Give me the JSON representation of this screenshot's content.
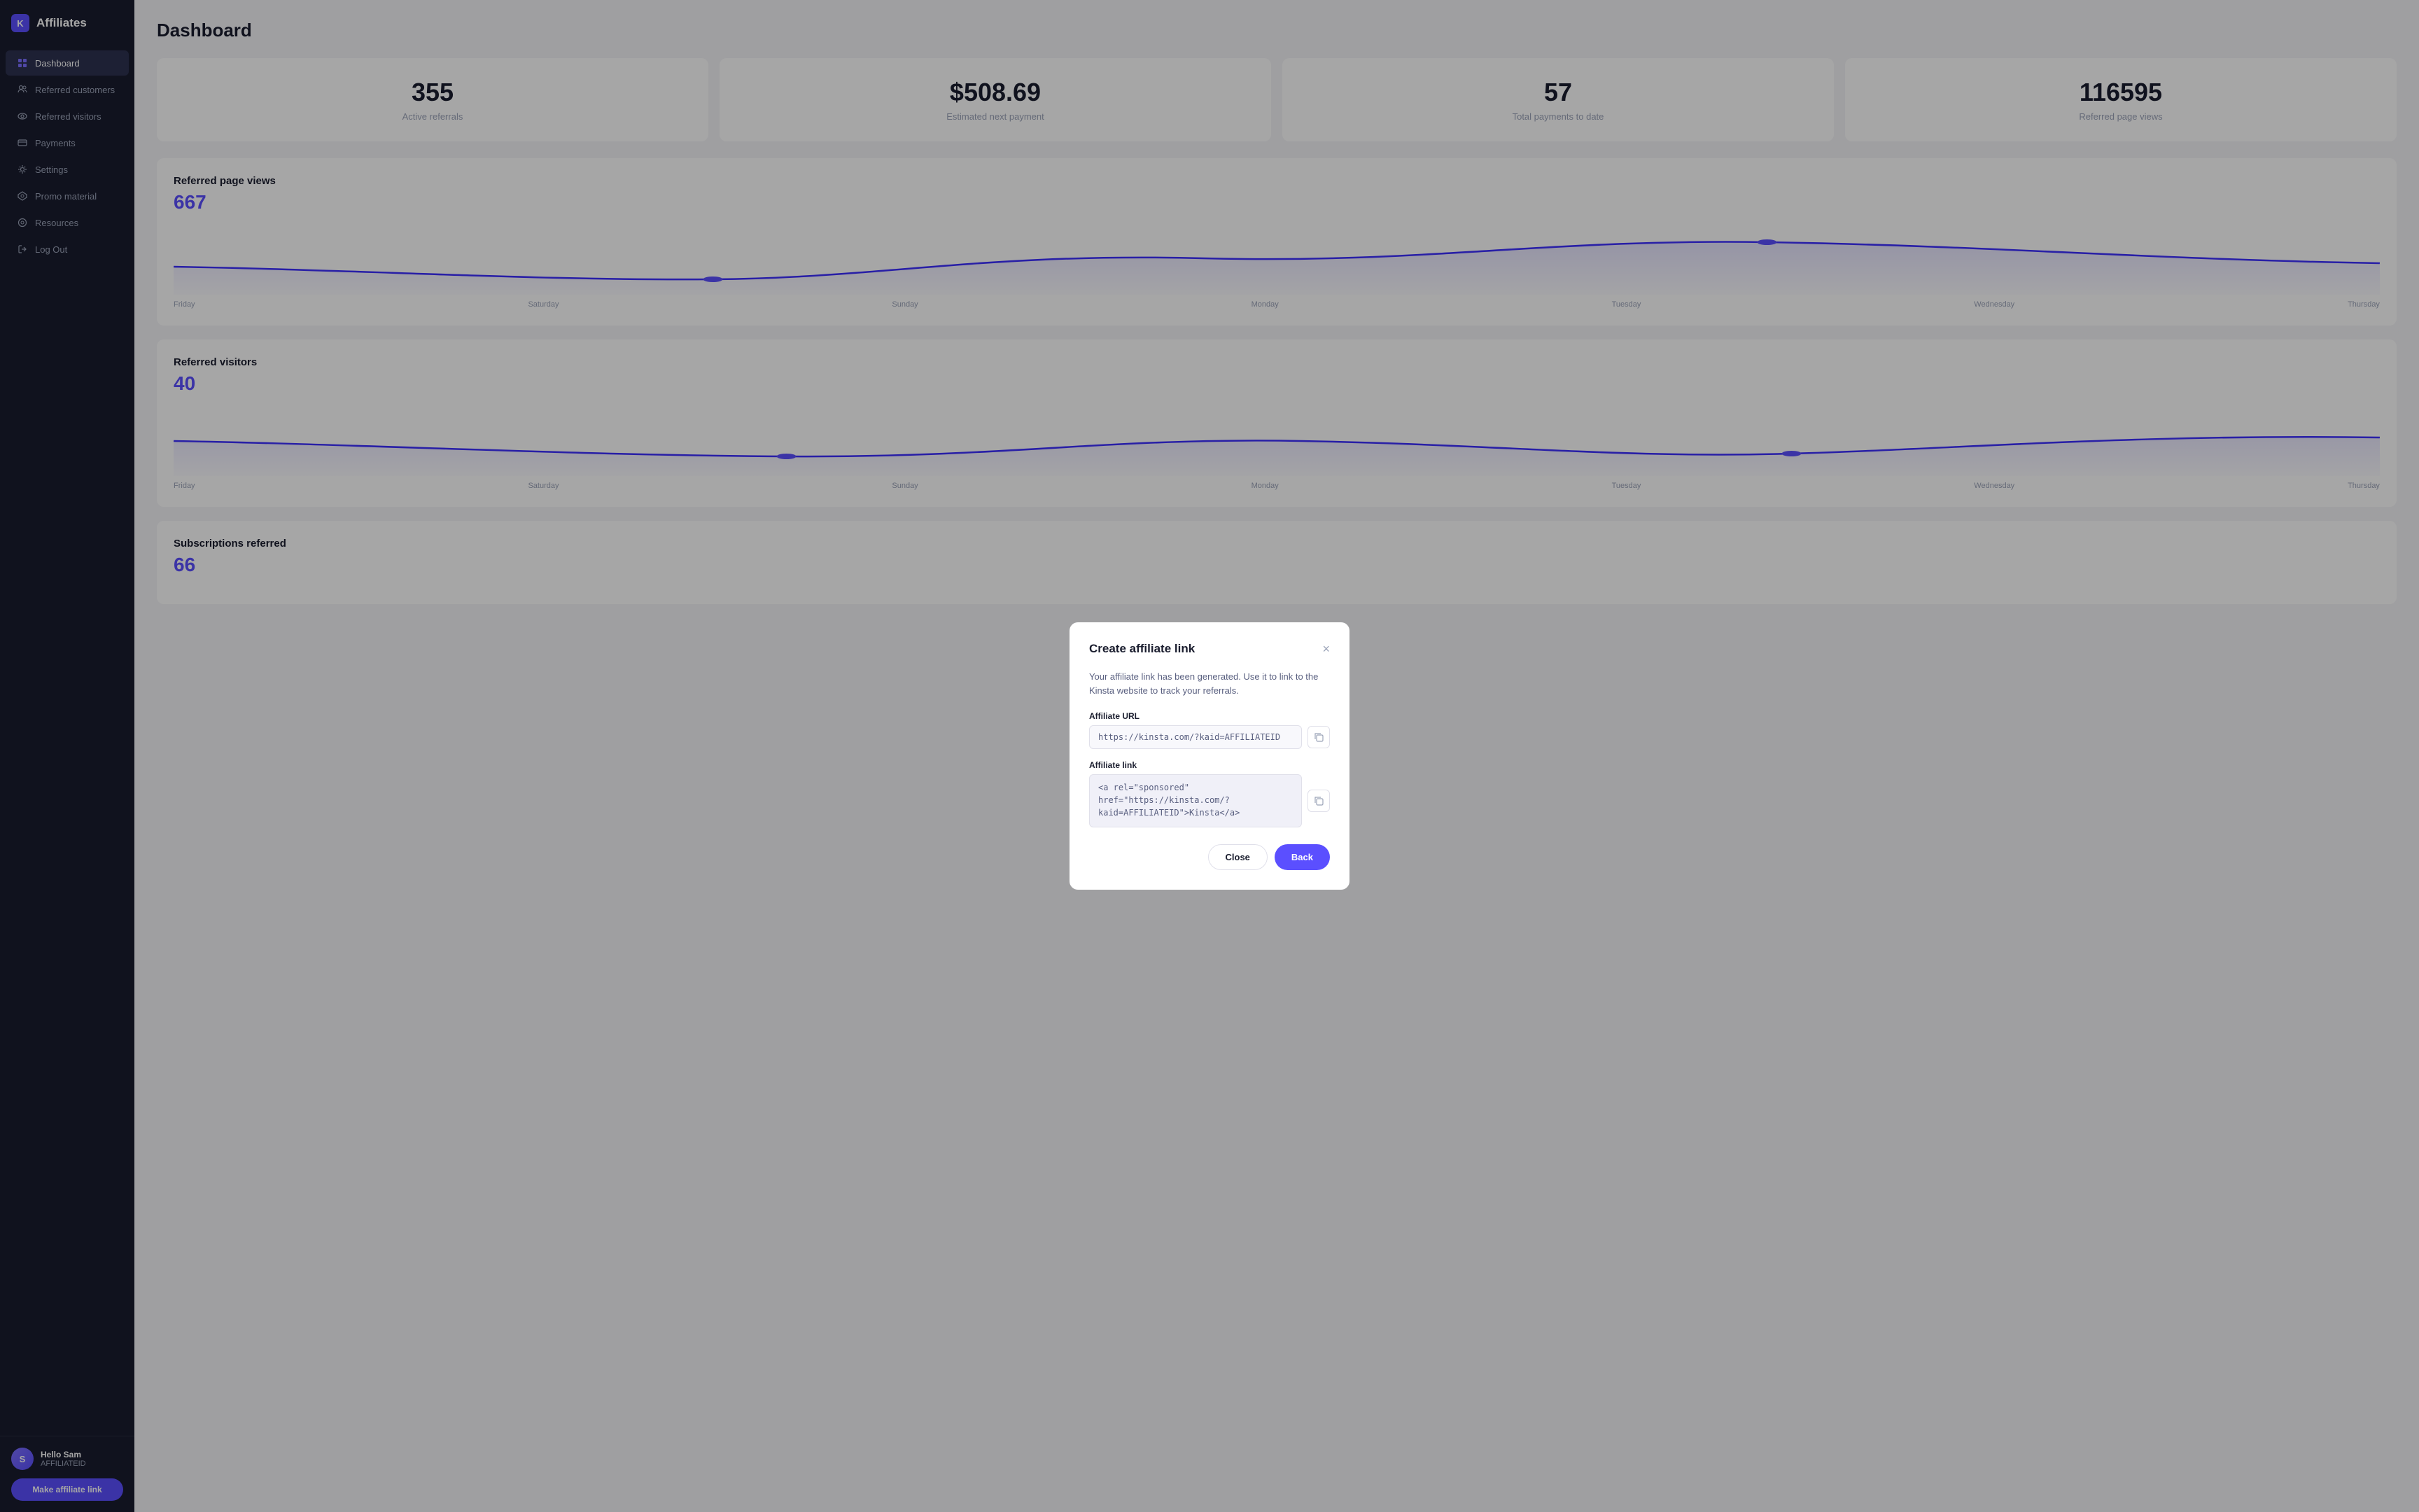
{
  "sidebar": {
    "brand_icon": "K",
    "brand_label": "Affiliates",
    "nav_items": [
      {
        "id": "dashboard",
        "label": "Dashboard",
        "icon": "⬡",
        "active": true
      },
      {
        "id": "referred-customers",
        "label": "Referred customers",
        "icon": "👥",
        "active": false
      },
      {
        "id": "referred-visitors",
        "label": "Referred visitors",
        "icon": "👁",
        "active": false
      },
      {
        "id": "payments",
        "label": "Payments",
        "icon": "💳",
        "active": false
      },
      {
        "id": "settings",
        "label": "Settings",
        "icon": "⚙",
        "active": false
      },
      {
        "id": "promo-material",
        "label": "Promo material",
        "icon": "◈",
        "active": false
      },
      {
        "id": "resources",
        "label": "Resources",
        "icon": "◎",
        "active": false
      },
      {
        "id": "logout",
        "label": "Log Out",
        "icon": "↩",
        "active": false
      }
    ],
    "user": {
      "avatar_initials": "S",
      "name": "Hello Sam",
      "id": "AFFILIATEID"
    },
    "affiliate_btn_label": "Make affiliate link"
  },
  "main": {
    "page_title": "Dashboard",
    "stats": [
      {
        "value": "355",
        "label": "Active referrals"
      },
      {
        "value": "$508.69",
        "label": "Estimated next payment"
      },
      {
        "value": "57",
        "label": "Total payments to date"
      },
      {
        "value": "116595",
        "label": "Referred page views"
      }
    ],
    "charts": [
      {
        "title": "Referred page views",
        "number": "667",
        "labels": [
          "Friday",
          "Saturday",
          "Sunday",
          "Monday",
          "Tuesday",
          "Wednesday",
          "Thursday"
        ]
      },
      {
        "title": "Referred visitors",
        "number": "40",
        "labels": [
          "Friday",
          "Saturday",
          "Sunday",
          "Monday",
          "Tuesday",
          "Wednesday",
          "Thursday"
        ]
      },
      {
        "title": "Subscriptions referred",
        "number": "66",
        "labels": []
      }
    ]
  },
  "modal": {
    "title": "Create affiliate link",
    "description": "Your affiliate link has been generated. Use it to link to the Kinsta website to track your referrals.",
    "url_label": "Affiliate URL",
    "url_value": "https://kinsta.com/?kaid=AFFILIATEID",
    "link_label": "Affiliate link",
    "link_value": "<a rel=\"sponsored\"\nhref=\"https://kinsta.com/?\nkaid=AFFILIATEID\">Kinsta</a>",
    "close_label": "Close",
    "back_label": "Back"
  }
}
